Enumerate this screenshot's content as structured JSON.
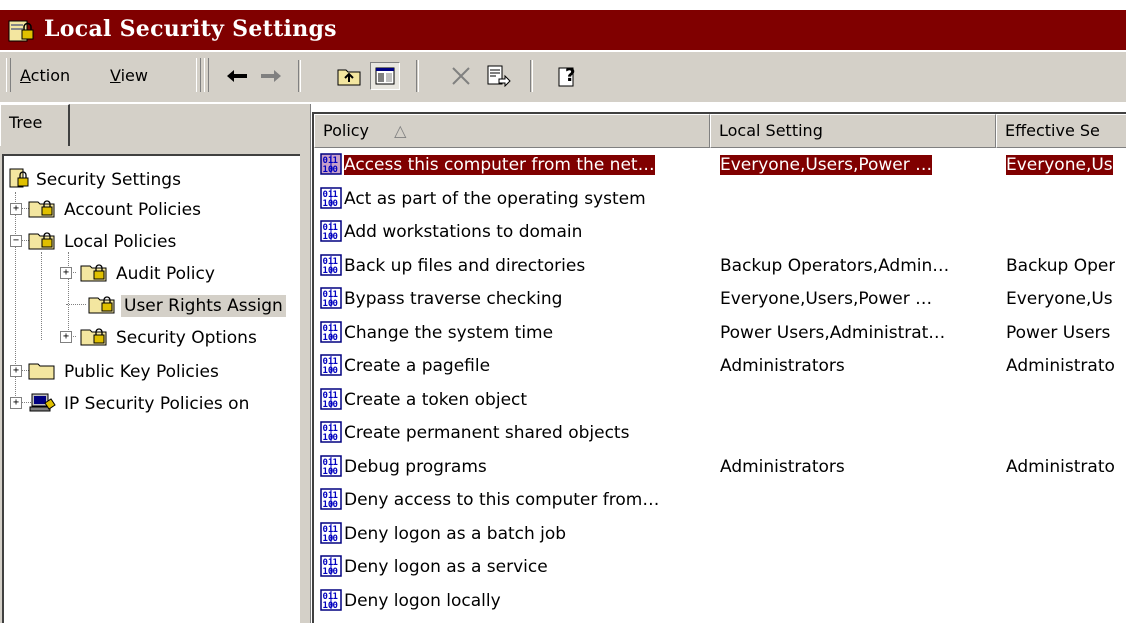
{
  "window": {
    "title": "Local Security Settings"
  },
  "menu": {
    "action": {
      "underlined": "A",
      "rest": "ction"
    },
    "view": {
      "underlined": "V",
      "rest": "iew"
    }
  },
  "toolbar_icons": [
    "back-arrow-icon",
    "forward-arrow-icon",
    "up-folder-icon",
    "show-hide-tree-icon",
    "delete-icon",
    "export-list-icon",
    "help-icon"
  ],
  "left": {
    "tab": "Tree",
    "tree": [
      {
        "label": "Security Settings",
        "icon": "security-settings-icon",
        "expander": ""
      },
      {
        "label": "Account Policies",
        "icon": "policy-folder-icon",
        "expander": "+"
      },
      {
        "label": "Local Policies",
        "icon": "policy-folder-icon",
        "expander": "-"
      },
      {
        "label": "Audit Policy",
        "icon": "policy-folder-icon",
        "expander": "+"
      },
      {
        "label": "User Rights Assign",
        "icon": "policy-folder-icon",
        "expander": ""
      },
      {
        "label": "Security Options",
        "icon": "policy-folder-icon",
        "expander": "+"
      },
      {
        "label": "Public Key Policies",
        "icon": "folder-icon",
        "expander": "+"
      },
      {
        "label": "IP Security Policies on",
        "icon": "ip-security-icon",
        "expander": "+"
      }
    ]
  },
  "list": {
    "columns": [
      "Policy",
      "Local Setting",
      "Effective Se"
    ],
    "sort_indicator": "△",
    "rows": [
      [
        "Access this computer from the net…",
        "Everyone,Users,Power …",
        "Everyone,Us"
      ],
      [
        "Act as part of the operating system",
        "",
        ""
      ],
      [
        "Add workstations to domain",
        "",
        ""
      ],
      [
        "Back up files and directories",
        "Backup Operators,Admin…",
        "Backup Oper"
      ],
      [
        "Bypass traverse checking",
        "Everyone,Users,Power …",
        "Everyone,Us"
      ],
      [
        "Change the system time",
        "Power Users,Administrat…",
        "Power Users"
      ],
      [
        "Create a pagefile",
        "Administrators",
        "Administrato"
      ],
      [
        "Create a token object",
        "",
        ""
      ],
      [
        "Create permanent shared objects",
        "",
        ""
      ],
      [
        "Debug programs",
        "Administrators",
        "Administrato"
      ],
      [
        "Deny access to this computer from…",
        "",
        ""
      ],
      [
        "Deny logon as a batch job",
        "",
        ""
      ],
      [
        "Deny logon as a service",
        "",
        ""
      ],
      [
        "Deny logon locally",
        "",
        ""
      ]
    ]
  },
  "colors": {
    "title_bar": "#800000",
    "selection": "#800000",
    "chrome": "#d4d0c8"
  }
}
